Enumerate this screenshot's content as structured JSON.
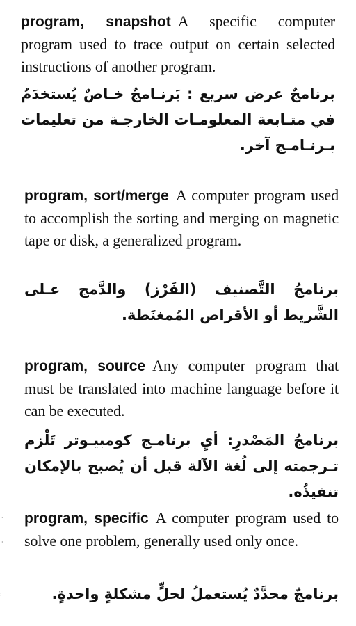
{
  "entries": [
    {
      "term": "program, snapshot",
      "definition": "A specific computer program used to trace output on certain selected instructions of another program.",
      "arabic": "برنامجٌ عرض سريع : بَرنـامجٌ خـاصٌ يُستخدَمُ في متـابعة المعلومـات الخارجـة من تعليمات بـرنـامـج آخر."
    },
    {
      "term": "program, sort/merge",
      "definition": "A computer program used to accomplish the sorting and merging on magnetic tape or disk, a generalized program.",
      "arabic": "برنامجُ التَّصنيف (الفَرْز) والدَّمج عـلى الشَّريط أو الأقراص المُمغنَطة."
    },
    {
      "term": "program, source",
      "definition": "Any computer program that must be translated into machine language before it can be executed.",
      "arabic": "برنامجُ المَصْدرِ: أيِ برنامـج كومبيـوتر تَلْزم تـرجمته إلى لُغة الآلة قبل أن يُصبح بالإمكان تنفيذُه."
    },
    {
      "term": "program, specific",
      "definition": "A computer program used to solve one problem, generally used only once.",
      "arabic": "برنامجٌ محدَّدٌ يُستعملُ لحلٍّ مشكلةٍ واحدةٍ."
    }
  ]
}
